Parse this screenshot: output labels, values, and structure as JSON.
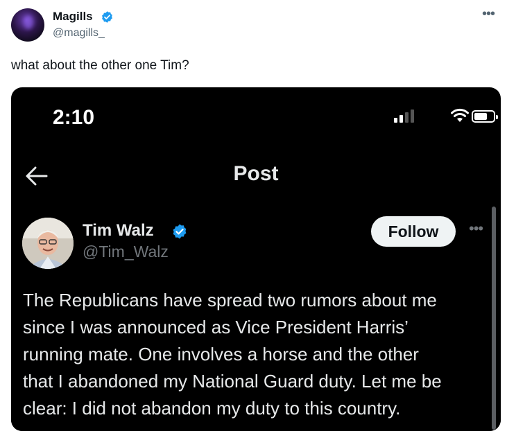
{
  "author": {
    "name": "Magills",
    "handle": "@magills_"
  },
  "tweet": {
    "text": "what about the other one Tim?"
  },
  "screenshot": {
    "status_time": "2:10",
    "nav_title": "Post",
    "quoted": {
      "name": "Tim Walz",
      "handle": "@Tim_Walz",
      "follow_label": "Follow",
      "lines": [
        "The Republicans have spread two rumors about me",
        "since I was announced as Vice President Harris’",
        "running mate. One involves a horse and the other",
        "that I abandoned my National Guard duty. Let me be",
        "clear: I did not abandon my duty to this country."
      ]
    }
  },
  "icons": {
    "verified": "verified-badge-icon",
    "more": "more-options-icon",
    "back": "back-arrow-icon",
    "signal": "cellular-signal-icon",
    "wifi": "wifi-icon",
    "battery": "battery-icon"
  },
  "colors": {
    "verified_blue": "#1d9bf0",
    "text": "#0f1419",
    "muted": "#536471"
  }
}
